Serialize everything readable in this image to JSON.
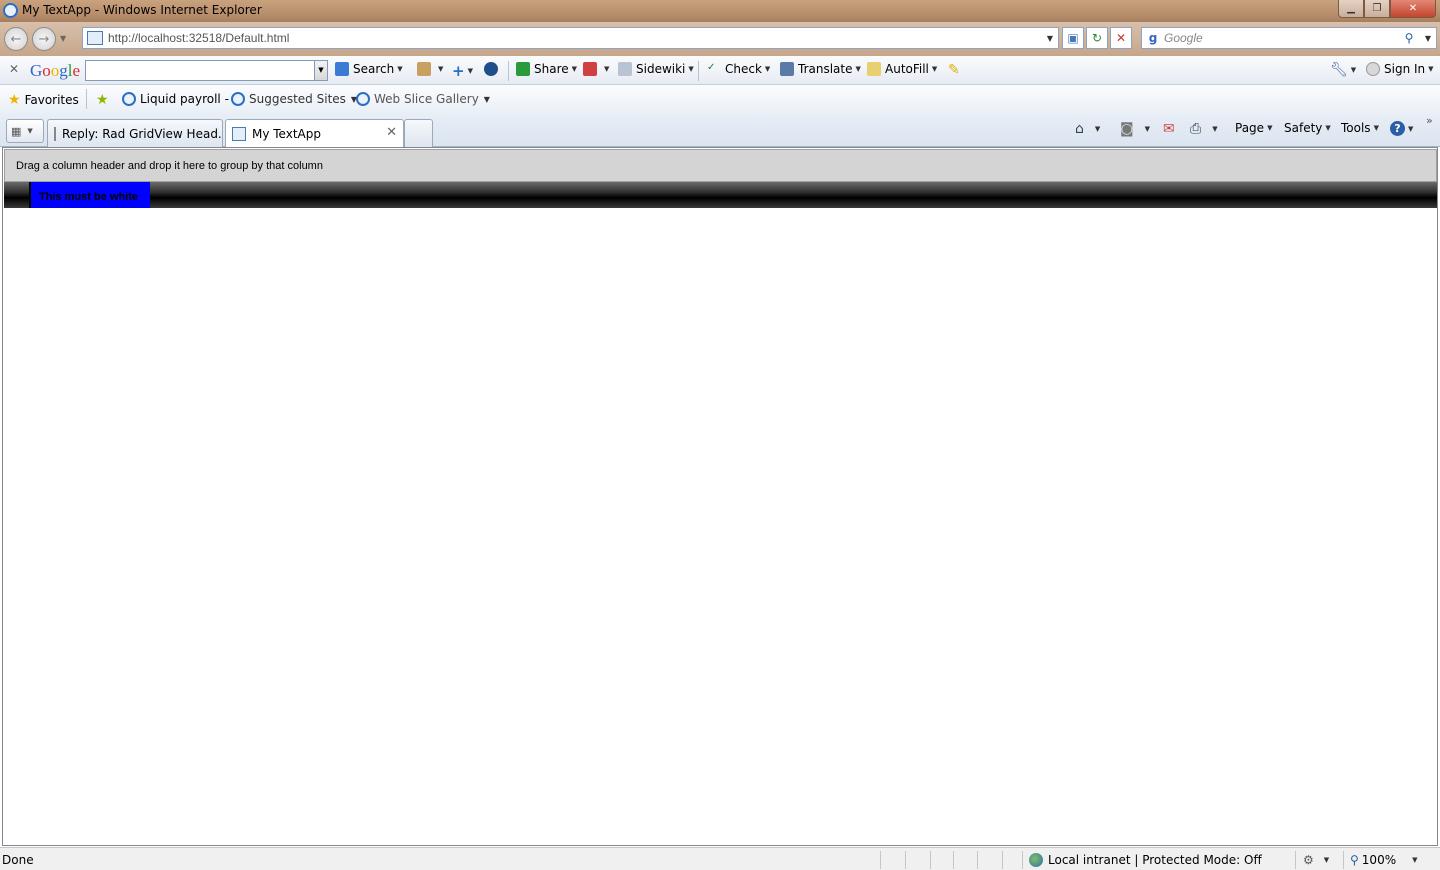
{
  "window": {
    "title": "My TextApp - Windows Internet Explorer"
  },
  "address": {
    "url": "http://localhost:32518/Default.html",
    "search_placeholder": "Google"
  },
  "google_toolbar": {
    "logo": "Google",
    "items": [
      "Search",
      "Share",
      "Sidewiki",
      "Check",
      "Translate",
      "AutoFill",
      "Sign In"
    ]
  },
  "favorites_bar": {
    "favorites_label": "Favorites",
    "links": [
      "Liquid payroll -",
      "Suggested Sites",
      "Web Slice Gallery"
    ]
  },
  "tabs": [
    {
      "label": "Reply: Rad GridView Head..."
    },
    {
      "label": "My TextApp"
    }
  ],
  "command_bar": {
    "page": "Page",
    "safety": "Safety",
    "tools": "Tools"
  },
  "grid": {
    "group_panel_text": "Drag a column header and drop it here to group by that column",
    "column_header": "This must be white"
  },
  "status_bar": {
    "status": "Done",
    "zone": "Local intranet | Protected Mode: Off",
    "zoom": "100%"
  },
  "colors": {
    "column_header_bg": "#0000ff",
    "header_bar": "#000000"
  }
}
